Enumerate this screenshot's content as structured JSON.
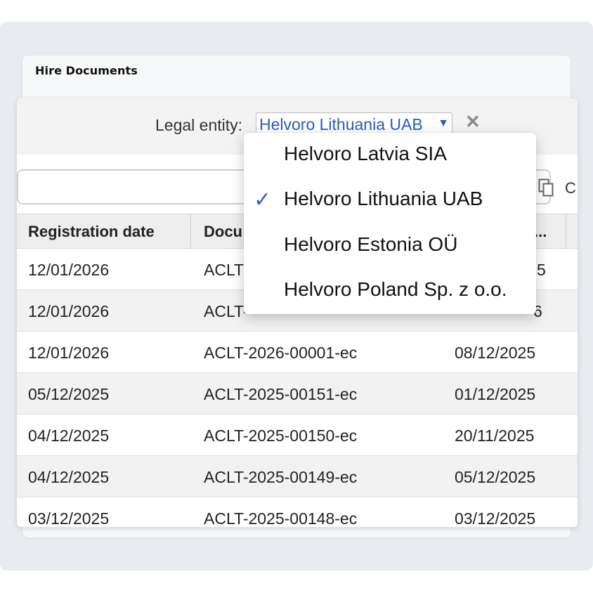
{
  "window": {
    "title": "Hire Documents"
  },
  "filter": {
    "legal_entity_label": "Legal entity:",
    "legal_entity_value": "Helvoro Lithuania UAB",
    "dropdown_arrow": "▼",
    "clear_glyph": "✕"
  },
  "toolbar": {
    "search_placeholder": "",
    "copy_label": "C"
  },
  "table": {
    "columns": [
      "Registration date",
      "Docu",
      "..."
    ],
    "rows": [
      [
        "12/01/2026",
        "ACLT",
        "5"
      ],
      [
        "12/01/2026",
        "ACLT-",
        "6"
      ],
      [
        "12/01/2026",
        "ACLT-2026-00001-ec",
        "08/12/2025"
      ],
      [
        "05/12/2025",
        "ACLT-2025-00151-ec",
        "01/12/2025"
      ],
      [
        "04/12/2025",
        "ACLT-2025-00150-ec",
        "20/11/2025"
      ],
      [
        "04/12/2025",
        "ACLT-2025-00149-ec",
        "05/12/2025"
      ],
      [
        "03/12/2025",
        "ACLT-2025-00148-ec",
        "03/12/2025"
      ]
    ]
  },
  "dropdown": {
    "options": [
      {
        "label": "Helvoro Latvia SIA",
        "selected": false
      },
      {
        "label": "Helvoro Lithuania UAB",
        "selected": true
      },
      {
        "label": "Helvoro Estonia OÜ",
        "selected": false
      },
      {
        "label": "Helvoro Poland Sp. z o.o.",
        "selected": false
      }
    ],
    "check_glyph": "✓"
  },
  "colors": {
    "accent_blue": "#2a5db8",
    "check_blue": "#2f5fd0",
    "page_bg": "#e8ecf0"
  },
  "icons": {
    "clear": "close-icon",
    "copy": "copy-icon",
    "dropdown": "chevron-down-icon",
    "check": "checkmark-icon"
  }
}
